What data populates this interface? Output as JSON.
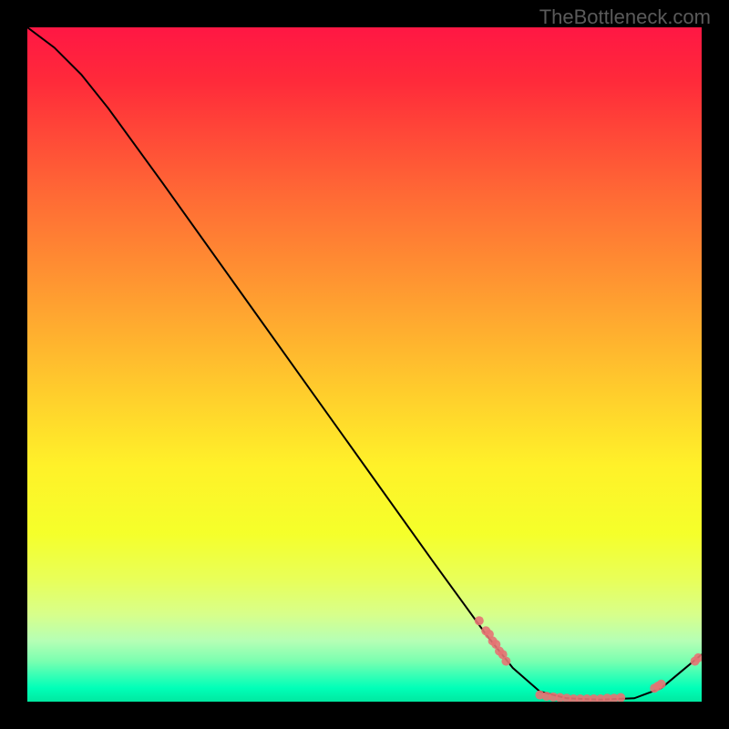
{
  "watermark": "TheBottleneck.com",
  "chart_data": {
    "type": "line",
    "title": "",
    "xlabel": "",
    "ylabel": "",
    "xlim": [
      0,
      100
    ],
    "ylim": [
      0,
      100
    ],
    "curve": [
      {
        "x": 0,
        "y": 100
      },
      {
        "x": 4,
        "y": 97
      },
      {
        "x": 8,
        "y": 93
      },
      {
        "x": 12,
        "y": 88
      },
      {
        "x": 20,
        "y": 77
      },
      {
        "x": 30,
        "y": 63
      },
      {
        "x": 40,
        "y": 49
      },
      {
        "x": 50,
        "y": 35
      },
      {
        "x": 60,
        "y": 21
      },
      {
        "x": 68,
        "y": 10
      },
      {
        "x": 72,
        "y": 5
      },
      {
        "x": 76,
        "y": 1.5
      },
      {
        "x": 80,
        "y": 0.5
      },
      {
        "x": 85,
        "y": 0.3
      },
      {
        "x": 90,
        "y": 0.5
      },
      {
        "x": 94,
        "y": 2
      },
      {
        "x": 97,
        "y": 4.5
      },
      {
        "x": 100,
        "y": 7
      }
    ],
    "dots": [
      {
        "x": 67,
        "y": 12
      },
      {
        "x": 68,
        "y": 10.5
      },
      {
        "x": 68.5,
        "y": 10
      },
      {
        "x": 69,
        "y": 9
      },
      {
        "x": 69.5,
        "y": 8.5
      },
      {
        "x": 70,
        "y": 7.5
      },
      {
        "x": 70.5,
        "y": 7
      },
      {
        "x": 71,
        "y": 6
      },
      {
        "x": 76,
        "y": 1
      },
      {
        "x": 77,
        "y": 0.8
      },
      {
        "x": 78,
        "y": 0.7
      },
      {
        "x": 79,
        "y": 0.6
      },
      {
        "x": 80,
        "y": 0.5
      },
      {
        "x": 81,
        "y": 0.4
      },
      {
        "x": 82,
        "y": 0.4
      },
      {
        "x": 83,
        "y": 0.4
      },
      {
        "x": 84,
        "y": 0.4
      },
      {
        "x": 85,
        "y": 0.4
      },
      {
        "x": 86,
        "y": 0.5
      },
      {
        "x": 87,
        "y": 0.5
      },
      {
        "x": 88,
        "y": 0.6
      },
      {
        "x": 93,
        "y": 2
      },
      {
        "x": 93.5,
        "y": 2.3
      },
      {
        "x": 94,
        "y": 2.6
      },
      {
        "x": 99,
        "y": 6
      },
      {
        "x": 99.5,
        "y": 6.5
      }
    ],
    "colors": {
      "line": "#000000",
      "dots": "#e57373",
      "gradient_top": "#ff1744",
      "gradient_bottom": "#00e8a0"
    }
  }
}
